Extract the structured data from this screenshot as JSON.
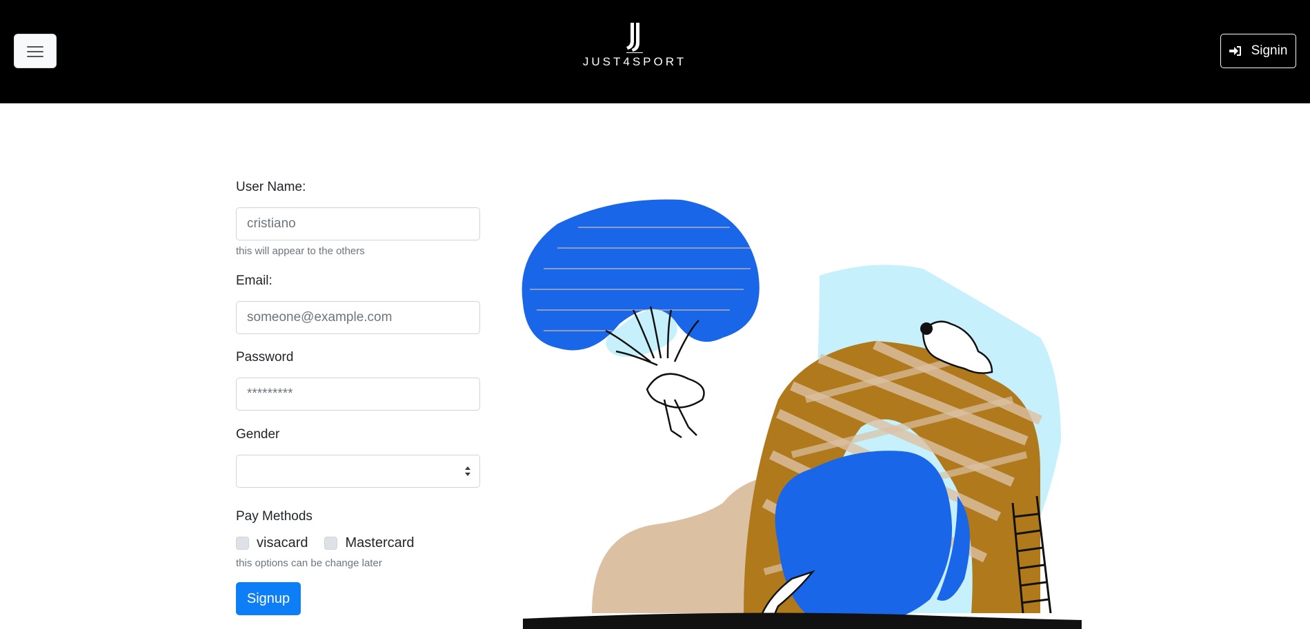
{
  "header": {
    "brand_name": "JUST4SPORT",
    "signin_label": "Signin",
    "logo_icon": "juventus-j-logo-icon",
    "menu_icon": "hamburger-menu-icon",
    "signin_icon": "sign-in-icon"
  },
  "form": {
    "username": {
      "label": "User Name:",
      "placeholder": "cristiano",
      "help": "this will appear to the others"
    },
    "email": {
      "label": "Email:",
      "placeholder": "someone@example.com"
    },
    "password": {
      "label": "Password",
      "placeholder": "*********"
    },
    "gender": {
      "label": "Gender",
      "value": ""
    },
    "pay_methods": {
      "label": "Pay Methods",
      "options": [
        "visacard",
        "Mastercard"
      ],
      "help": "this options can be change later"
    },
    "submit_label": "Signup"
  },
  "colors": {
    "header_bg": "#000000",
    "primary": "#0d7ef5",
    "illustration_blue": "#1a66e8",
    "illustration_light_blue": "#c6f0fb",
    "illustration_brown": "#b07a1c",
    "illustration_tan": "#dcc0a2"
  }
}
